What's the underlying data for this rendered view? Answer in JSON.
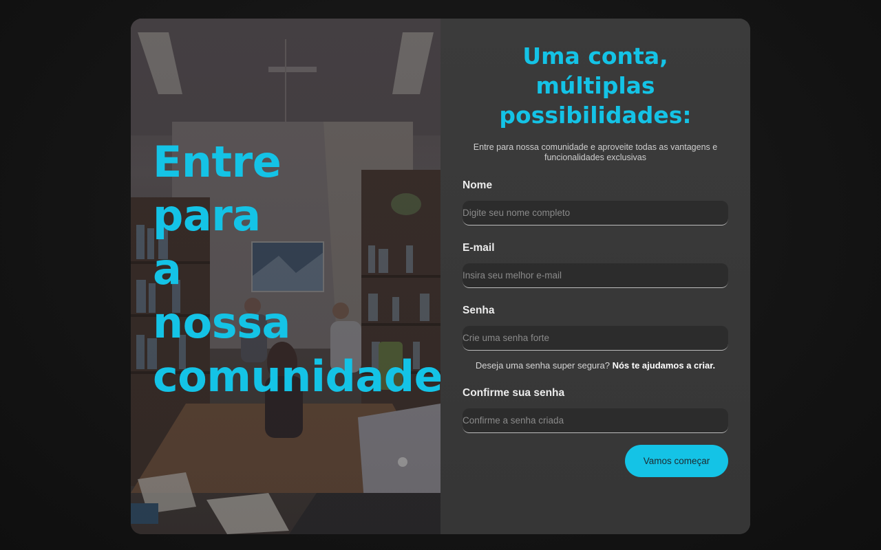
{
  "hero": {
    "title_lines": [
      "Entre",
      "para",
      "a",
      "nossa",
      "comunidade"
    ]
  },
  "form": {
    "heading": "Uma conta, múltiplas possibilidades:",
    "subtitle": "Entre para nossa comunidade e aproveite todas as vantagens e funcionalidades exclusivas",
    "fields": [
      {
        "label": "Nome",
        "placeholder": "Digite seu nome completo",
        "value": ""
      },
      {
        "label": "E-mail",
        "placeholder": "Insira seu melhor e-mail",
        "value": ""
      },
      {
        "label": "Senha",
        "placeholder": "Crie uma senha forte",
        "value": ""
      },
      {
        "label": "Confirme sua senha",
        "placeholder": "Confirme a senha criada",
        "value": ""
      }
    ],
    "password_hint": {
      "text": "Deseja uma senha super segura?",
      "link": "Nós te ajudamos a criar."
    },
    "submit_label": "Vamos começar"
  },
  "colors": {
    "accent": "#14c3e6",
    "page_background": "#141414",
    "panel_background": "#3a3a3a",
    "input_background": "#2c2c2c"
  },
  "icons": {
    "hero_image": "office-meeting-photo"
  }
}
